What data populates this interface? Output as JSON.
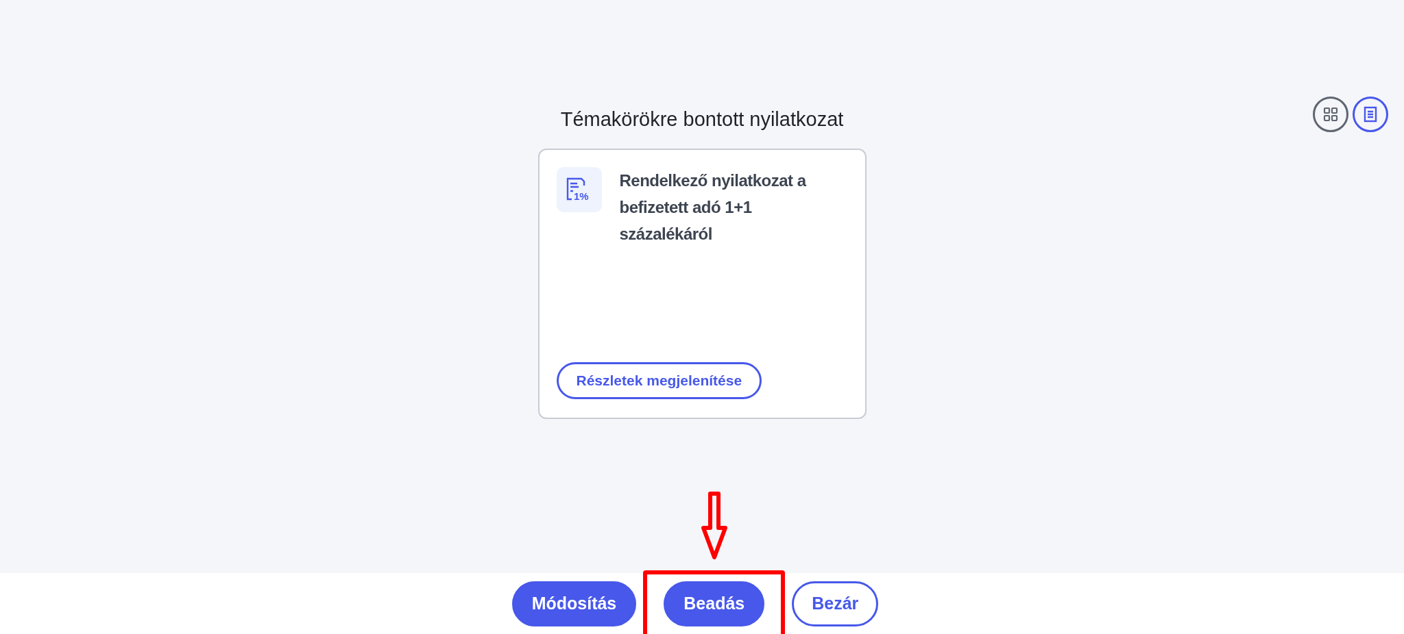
{
  "heading": "Témakörökre bontott nyilatkozat",
  "view_toggle": [
    {
      "kind": "grid",
      "selected": false
    },
    {
      "kind": "list",
      "selected": true
    }
  ],
  "cards": [
    {
      "icon_label": "1%",
      "title": "Rendelkező nyilatkozat a befizetett adó 1+1 százalékáról",
      "button": "Részletek megjelenítése"
    }
  ],
  "footer_buttons": [
    {
      "label": "Módosítás",
      "kind": "primary",
      "highlighted": false
    },
    {
      "label": "Beadás",
      "kind": "primary",
      "highlighted": true
    },
    {
      "label": "Bezár",
      "kind": "outline",
      "highlighted": false
    }
  ]
}
